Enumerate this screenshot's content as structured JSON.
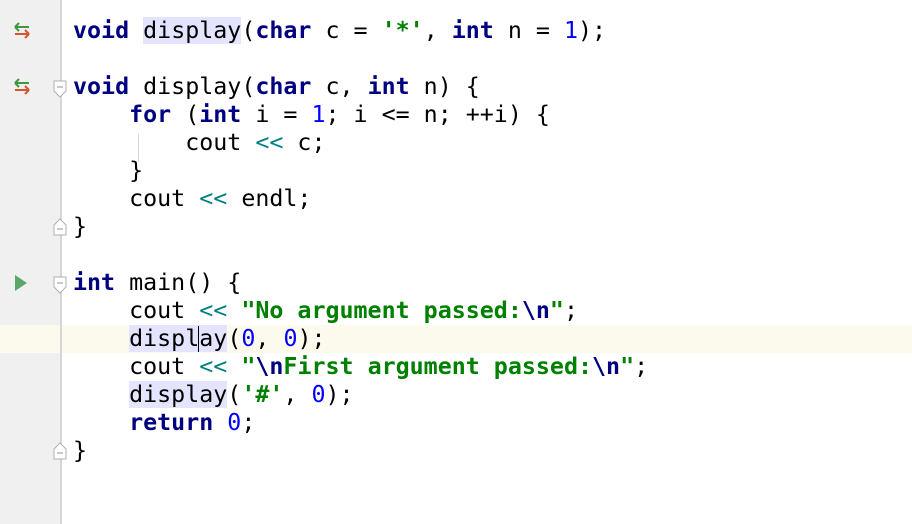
{
  "editor": {
    "language": "C++",
    "caret_line": 12,
    "colors": {
      "keyword": "#000080",
      "number": "#0000ff",
      "string": "#008000",
      "operator": "#008080",
      "usage_highlight": "#e4e4ff",
      "caret_row": "#fcfaed",
      "gutter": "#f0f0f0"
    },
    "gutter_icons": [
      {
        "line": 1,
        "icon": "declaration-definition-arrows-icon"
      },
      {
        "line": 3,
        "icon": "declaration-definition-arrows-icon"
      },
      {
        "line": 11,
        "icon": "run-arrow-icon"
      }
    ],
    "lines": [
      {
        "tokens": [
          [
            "kw",
            "void"
          ],
          [
            "t",
            " "
          ],
          [
            "fn",
            "display"
          ],
          [
            "t",
            "("
          ],
          [
            "kw",
            "char"
          ],
          [
            "t",
            " c = "
          ],
          [
            "str",
            "'*'"
          ],
          [
            "t",
            ", "
          ],
          [
            "kw",
            "int"
          ],
          [
            "t",
            " n = "
          ],
          [
            "num",
            "1"
          ],
          [
            "t",
            ");"
          ]
        ]
      },
      {
        "tokens": []
      },
      {
        "tokens": [
          [
            "kw",
            "void"
          ],
          [
            "t",
            " display("
          ],
          [
            "kw",
            "char"
          ],
          [
            "t",
            " c, "
          ],
          [
            "kw",
            "int"
          ],
          [
            "t",
            " n) {"
          ]
        ]
      },
      {
        "tokens": [
          [
            "t",
            "    "
          ],
          [
            "kw",
            "for"
          ],
          [
            "t",
            " ("
          ],
          [
            "kw",
            "int"
          ],
          [
            "t",
            " i = "
          ],
          [
            "num",
            "1"
          ],
          [
            "t",
            "; i <= n; ++i) {"
          ]
        ]
      },
      {
        "tokens": [
          [
            "t",
            "        cout "
          ],
          [
            "op",
            "<<"
          ],
          [
            "t",
            " c;"
          ]
        ]
      },
      {
        "tokens": [
          [
            "t",
            "    }"
          ]
        ]
      },
      {
        "tokens": [
          [
            "t",
            "    cout "
          ],
          [
            "op",
            "<<"
          ],
          [
            "t",
            " endl;"
          ]
        ]
      },
      {
        "tokens": [
          [
            "t",
            "}"
          ]
        ]
      },
      {
        "tokens": []
      },
      {
        "tokens": [
          [
            "kw",
            "int"
          ],
          [
            "t",
            " main() {"
          ]
        ]
      },
      {
        "tokens": [
          [
            "t",
            "    cout "
          ],
          [
            "op",
            "<<"
          ],
          [
            "t",
            " "
          ],
          [
            "str",
            "\"No argument passed:"
          ],
          [
            "esc",
            "\\n"
          ],
          [
            "str",
            "\""
          ],
          [
            "t",
            ";"
          ]
        ]
      },
      {
        "tokens": [
          [
            "t",
            "    "
          ],
          [
            "fn",
            "displ"
          ],
          [
            "caret",
            ""
          ],
          [
            "fn",
            "ay"
          ],
          [
            "t",
            "("
          ],
          [
            "num",
            "0"
          ],
          [
            "t",
            ", "
          ],
          [
            "num",
            "0"
          ],
          [
            "t",
            ");"
          ]
        ]
      },
      {
        "tokens": [
          [
            "t",
            "    cout "
          ],
          [
            "op",
            "<<"
          ],
          [
            "t",
            " "
          ],
          [
            "str",
            "\""
          ],
          [
            "esc",
            "\\n"
          ],
          [
            "str",
            "First argument passed:"
          ],
          [
            "esc",
            "\\n"
          ],
          [
            "str",
            "\""
          ],
          [
            "t",
            ";"
          ]
        ]
      },
      {
        "tokens": [
          [
            "t",
            "    "
          ],
          [
            "fn",
            "display"
          ],
          [
            "t",
            "("
          ],
          [
            "str",
            "'#'"
          ],
          [
            "t",
            ", "
          ],
          [
            "num",
            "0"
          ],
          [
            "t",
            ");"
          ]
        ]
      },
      {
        "tokens": [
          [
            "t",
            "    "
          ],
          [
            "kw",
            "return"
          ],
          [
            "t",
            " "
          ],
          [
            "num",
            "0"
          ],
          [
            "t",
            ";"
          ]
        ]
      },
      {
        "tokens": [
          [
            "t",
            "}"
          ]
        ]
      }
    ]
  }
}
